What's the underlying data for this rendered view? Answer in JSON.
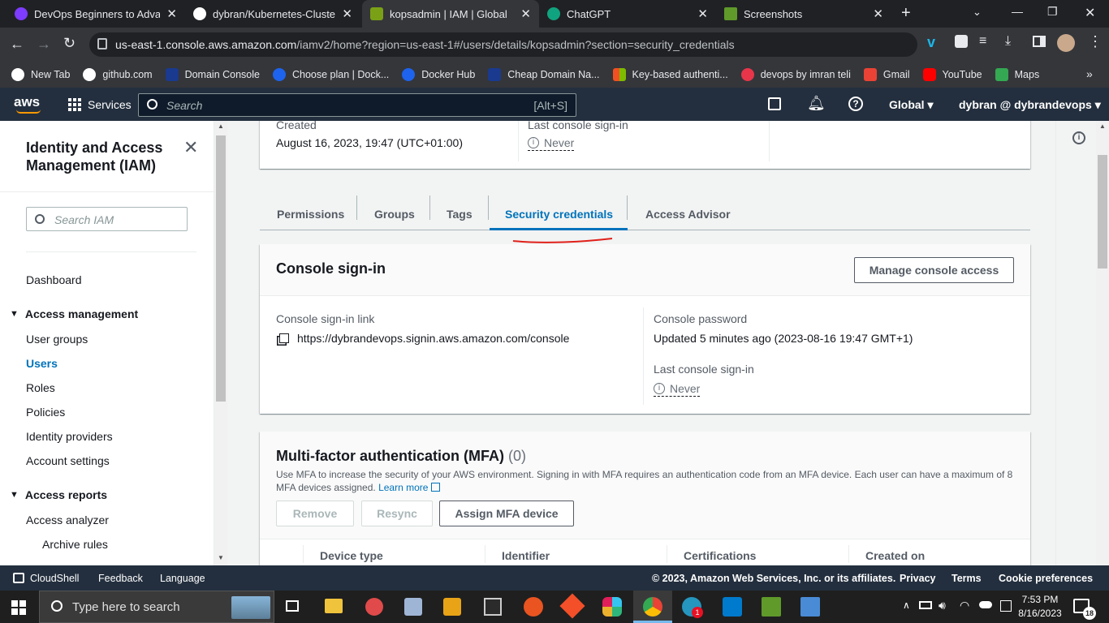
{
  "browser": {
    "tabs": [
      {
        "title": "DevOps Beginners to Advanc",
        "favicon_color": "#7d3cff"
      },
      {
        "title": "dybran/Kubernetes-Cluster-S",
        "favicon_color": "#ffffff"
      },
      {
        "title": "kopsadmin | IAM | Global",
        "favicon_color": "#7aa116"
      },
      {
        "title": "ChatGPT",
        "favicon_color": "#10a37f"
      },
      {
        "title": "Screenshots",
        "favicon_color": "#5f9a2a"
      }
    ],
    "url_host": "us-east-1.console.aws.amazon.com",
    "url_path": "/iamv2/home?region=us-east-1#/users/details/kopsadmin?section=security_credentials",
    "bookmarks": [
      {
        "label": "New Tab",
        "color": "#ffffff"
      },
      {
        "label": "github.com",
        "color": "#ffffff"
      },
      {
        "label": "Domain Console",
        "color": "#1a3a8f"
      },
      {
        "label": "Choose plan | Dock...",
        "color": "#1d63ed"
      },
      {
        "label": "Docker Hub",
        "color": "#1d63ed"
      },
      {
        "label": "Cheap Domain Na...",
        "color": "#1a3a8f"
      },
      {
        "label": "Key-based authenti...",
        "color": "#f25022"
      },
      {
        "label": "devops by imran teli",
        "color": "#e8354a"
      },
      {
        "label": "Gmail",
        "color": "#ea4335"
      },
      {
        "label": "YouTube",
        "color": "#ff0000"
      },
      {
        "label": "Maps",
        "color": "#34a853"
      }
    ]
  },
  "aws_nav": {
    "logo": "aws",
    "services": "Services",
    "search_placeholder": "Search",
    "search_shortcut": "[Alt+S]",
    "region": "Global",
    "account": "dybran @ dybrandevops"
  },
  "sidebar": {
    "title": "Identity and Access Management (IAM)",
    "search_placeholder": "Search IAM",
    "dashboard": "Dashboard",
    "section1": "Access management",
    "items": [
      "User groups",
      "Users",
      "Roles",
      "Policies",
      "Identity providers",
      "Account settings"
    ],
    "active": "Users",
    "section2": "Access reports",
    "reports": [
      "Access analyzer",
      "Archive rules"
    ]
  },
  "summary": {
    "created_label": "Created",
    "created_value": "August 16, 2023, 19:47 (UTC+01:00)",
    "last_signin_label": "Last console sign-in",
    "last_signin_value": "Never"
  },
  "tabs": [
    "Permissions",
    "Groups",
    "Tags",
    "Security credentials",
    "Access Advisor"
  ],
  "active_tab": "Security credentials",
  "console_signin": {
    "title": "Console sign-in",
    "manage_button": "Manage console access",
    "link_label": "Console sign-in link",
    "link_value": "https://dybrandevops.signin.aws.amazon.com/console",
    "password_label": "Console password",
    "password_value": "Updated 5 minutes ago (2023-08-16 19:47 GMT+1)",
    "last_signin_label": "Last console sign-in",
    "last_signin_value": "Never"
  },
  "mfa": {
    "title": "Multi-factor authentication (MFA)",
    "count": "(0)",
    "description": "Use MFA to increase the security of your AWS environment. Signing in with MFA requires an authentication code from an MFA device. Each user can have a maximum of 8 MFA devices assigned.",
    "learn_more": "Learn more",
    "remove": "Remove",
    "resync": "Resync",
    "assign": "Assign MFA device",
    "columns": [
      "Device type",
      "Identifier",
      "Certifications",
      "Created on"
    ]
  },
  "footer": {
    "cloudshell": "CloudShell",
    "feedback": "Feedback",
    "language": "Language",
    "copyright": "© 2023, Amazon Web Services, Inc. or its affiliates.",
    "privacy": "Privacy",
    "terms": "Terms",
    "cookies": "Cookie preferences"
  },
  "taskbar": {
    "search_placeholder": "Type here to search",
    "time": "7:53 PM",
    "date": "8/16/2023",
    "notification_count": "18",
    "slack_badge": "1"
  },
  "colors": {
    "aws_nav": "#232f3e",
    "link_blue": "#0073bb",
    "active_tab": "#0073bb",
    "annotation_red": "#e0201a"
  }
}
